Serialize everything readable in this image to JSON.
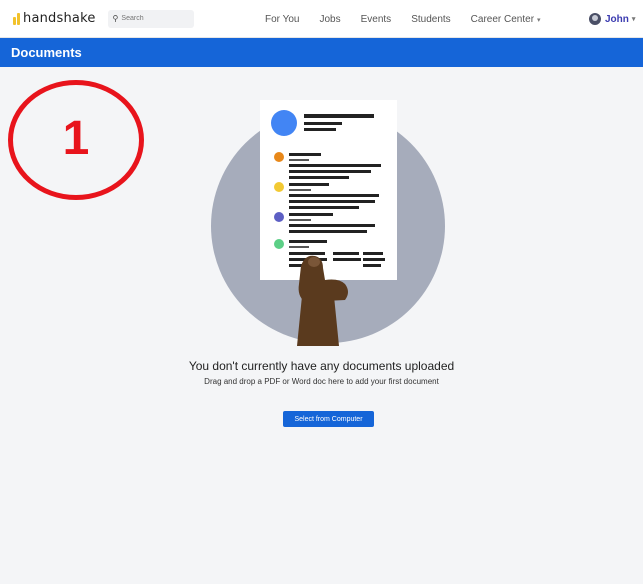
{
  "brand": {
    "name": "handshake",
    "logo_color": "#f2c22b"
  },
  "search": {
    "icon": "search-icon",
    "placeholder": "Search"
  },
  "nav": {
    "items": [
      {
        "label": "For You"
      },
      {
        "label": "Jobs"
      },
      {
        "label": "Events"
      },
      {
        "label": "Students"
      },
      {
        "label": "Career Center"
      }
    ],
    "dropdown_caret": "▾"
  },
  "user": {
    "name": "John",
    "avatar_icon": "user-avatar"
  },
  "header": {
    "title": "Documents",
    "color": "#1565d8"
  },
  "annotation": {
    "number": "1",
    "color": "#e8141c"
  },
  "empty_state": {
    "heading": "You don't currently have any documents uploaded",
    "subtext": "Drag and drop a PDF or Word doc here to add your first document",
    "button_label": "Select from Computer"
  }
}
